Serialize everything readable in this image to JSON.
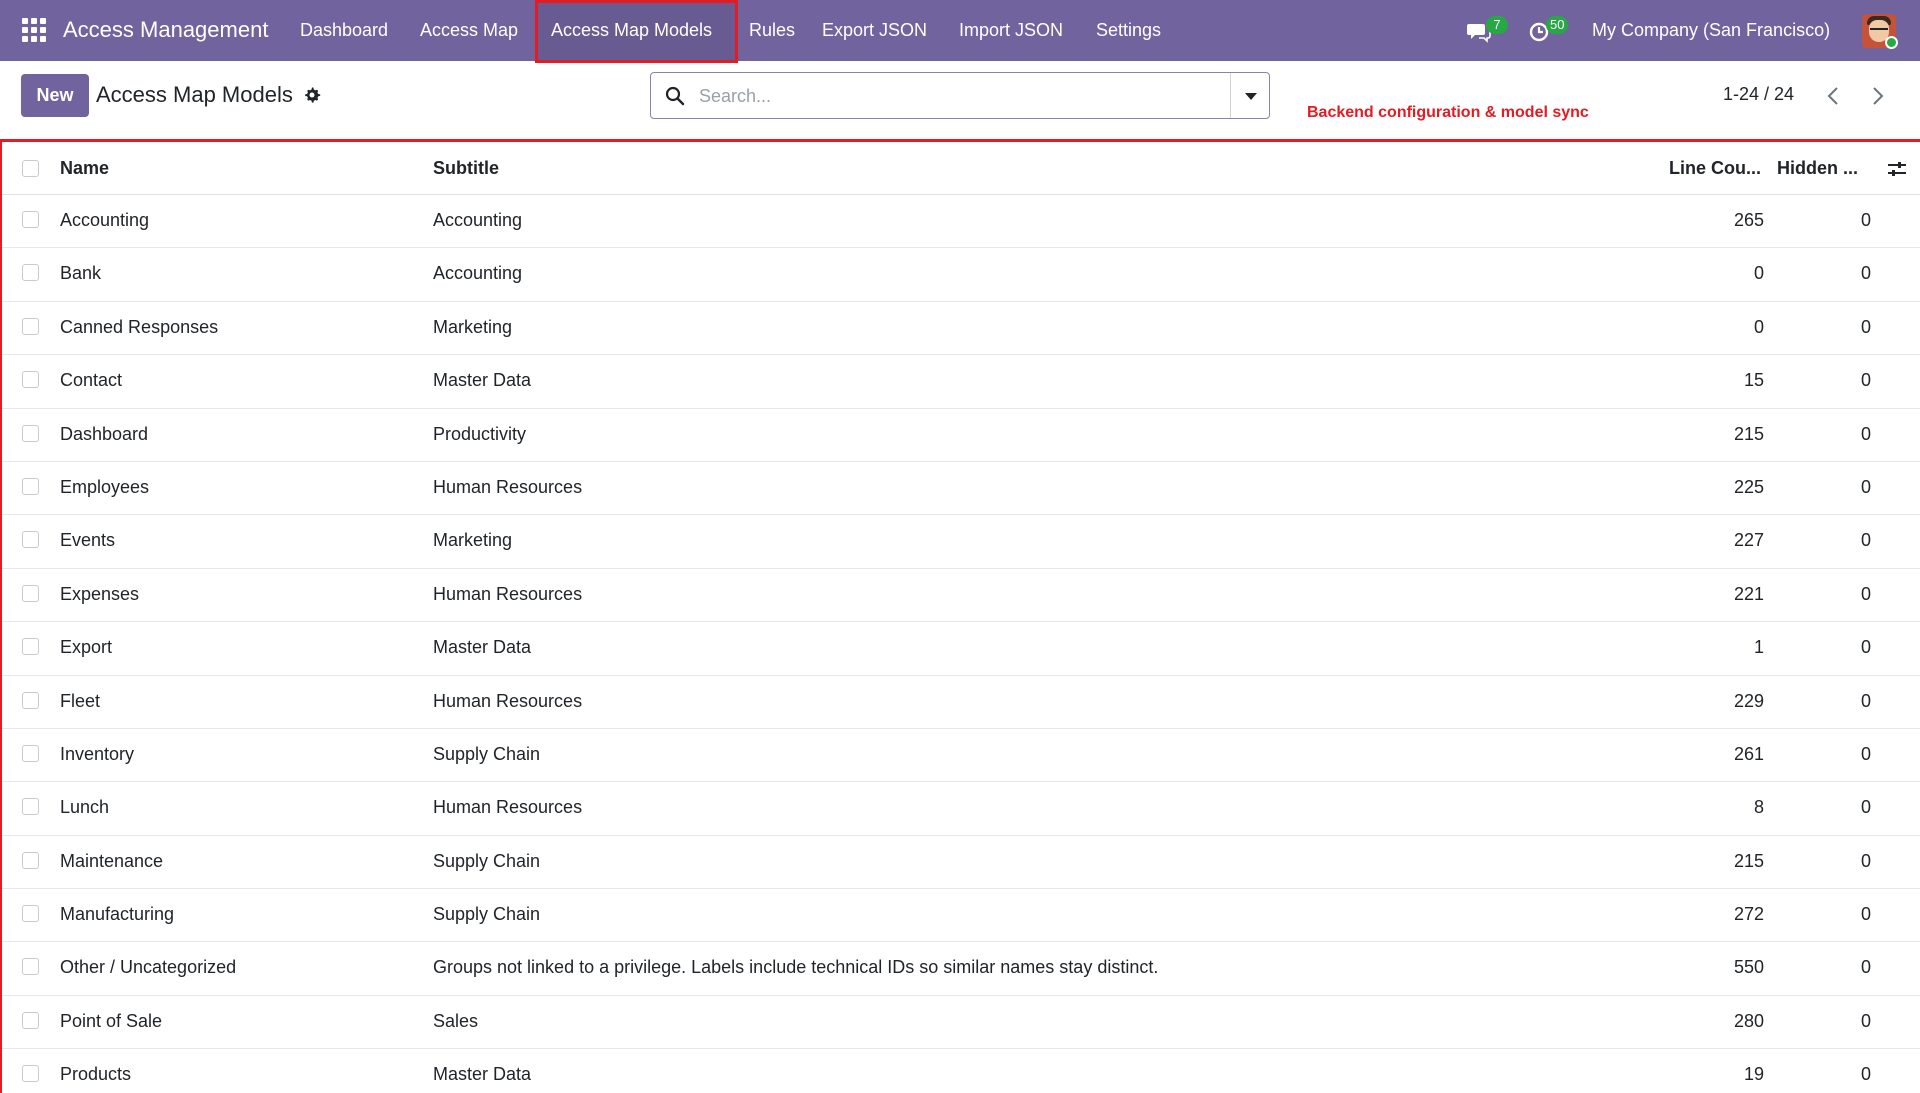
{
  "navbar": {
    "brand": "Access Management",
    "menu": [
      {
        "label": "Dashboard"
      },
      {
        "label": "Access Map"
      },
      {
        "label": "Access Map Models"
      },
      {
        "label": "Rules"
      },
      {
        "label": "Export JSON"
      },
      {
        "label": "Import JSON"
      },
      {
        "label": "Settings"
      }
    ],
    "messages_badge": "7",
    "activities_badge": "50",
    "company": "My Company (San Francisco)"
  },
  "control_panel": {
    "new_label": "New",
    "title": "Access Map Models",
    "search_placeholder": "Search...",
    "pager": "1-24 / 24",
    "annotation": "Backend configuration & model sync"
  },
  "table": {
    "headers": {
      "name": "Name",
      "subtitle": "Subtitle",
      "line_count": "Line Cou...",
      "hidden": "Hidden ..."
    },
    "rows": [
      {
        "name": "Accounting",
        "subtitle": "Accounting",
        "line_count": "265",
        "hidden": "0"
      },
      {
        "name": "Bank",
        "subtitle": "Accounting",
        "line_count": "0",
        "hidden": "0"
      },
      {
        "name": "Canned Responses",
        "subtitle": "Marketing",
        "line_count": "0",
        "hidden": "0"
      },
      {
        "name": "Contact",
        "subtitle": "Master Data",
        "line_count": "15",
        "hidden": "0"
      },
      {
        "name": "Dashboard",
        "subtitle": "Productivity",
        "line_count": "215",
        "hidden": "0"
      },
      {
        "name": "Employees",
        "subtitle": "Human Resources",
        "line_count": "225",
        "hidden": "0"
      },
      {
        "name": "Events",
        "subtitle": "Marketing",
        "line_count": "227",
        "hidden": "0"
      },
      {
        "name": "Expenses",
        "subtitle": "Human Resources",
        "line_count": "221",
        "hidden": "0"
      },
      {
        "name": "Export",
        "subtitle": "Master Data",
        "line_count": "1",
        "hidden": "0"
      },
      {
        "name": "Fleet",
        "subtitle": "Human Resources",
        "line_count": "229",
        "hidden": "0"
      },
      {
        "name": "Inventory",
        "subtitle": "Supply Chain",
        "line_count": "261",
        "hidden": "0"
      },
      {
        "name": "Lunch",
        "subtitle": "Human Resources",
        "line_count": "8",
        "hidden": "0"
      },
      {
        "name": "Maintenance",
        "subtitle": "Supply Chain",
        "line_count": "215",
        "hidden": "0"
      },
      {
        "name": "Manufacturing",
        "subtitle": "Supply Chain",
        "line_count": "272",
        "hidden": "0"
      },
      {
        "name": "Other / Uncategorized",
        "subtitle": "Groups not linked to a privilege. Labels include technical IDs so similar names stay distinct.",
        "line_count": "550",
        "hidden": "0"
      },
      {
        "name": "Point of Sale",
        "subtitle": "Sales",
        "line_count": "280",
        "hidden": "0"
      },
      {
        "name": "Products",
        "subtitle": "Master Data",
        "line_count": "19",
        "hidden": "0"
      }
    ]
  },
  "colors": {
    "navbar": "#71639e",
    "highlight": "#e31b23",
    "badge": "#28a745"
  },
  "icons": [
    "apps-grid-icon",
    "chat-icon",
    "clock-icon",
    "gear-icon",
    "search-icon",
    "caret-down-icon",
    "chevron-left-icon",
    "chevron-right-icon",
    "sliders-icon"
  ]
}
